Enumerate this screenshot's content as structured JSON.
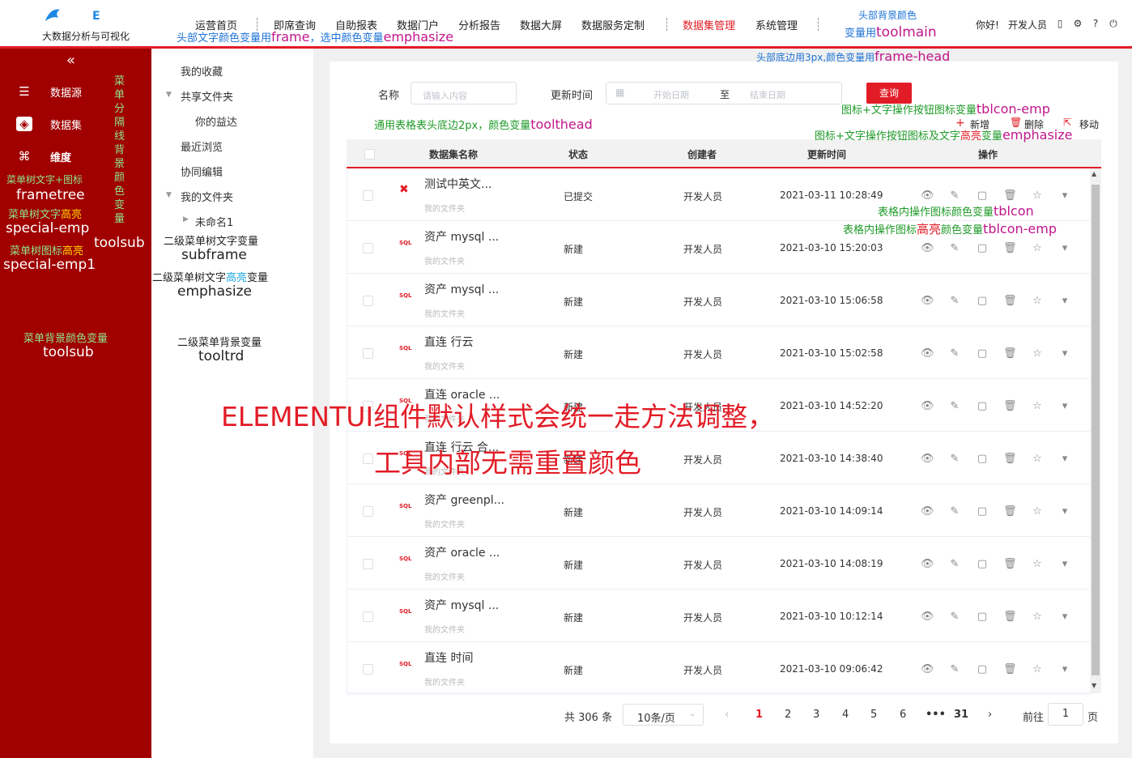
{
  "header": {
    "logo_e": "E",
    "logo_title": "大数据分析与可视化",
    "nav": [
      "运营首页",
      "即席查询",
      "自助报表",
      "数据门户",
      "分析报告",
      "数据大屏",
      "数据服务定制",
      "数据集管理",
      "系统管理"
    ],
    "active_nav": "数据集管理",
    "greeting": "你好!",
    "user": "开发人员",
    "icons": [
      "phone-icon",
      "gear-icon",
      "help-icon",
      "power-icon"
    ]
  },
  "sidebar": {
    "collapse_icon": "double-chevron-left-icon",
    "items": [
      {
        "label": "数据源",
        "icon": "database-icon"
      },
      {
        "label": "数据集",
        "icon": "layers-icon",
        "active": true
      },
      {
        "label": "维度",
        "icon": "nodes-icon"
      }
    ]
  },
  "subnav": {
    "items": [
      "我的收藏",
      "共享文件夹",
      "你的益达",
      "最近浏览",
      "协同编辑",
      "我的文件夹",
      "未命名1"
    ]
  },
  "filters": {
    "name_label": "名称",
    "name_placeholder": "请输入内容",
    "time_label": "更新时间",
    "start_placeholder": "开始日期",
    "to": "至",
    "end_placeholder": "结束日期",
    "query": "查询"
  },
  "toolbar": {
    "add": "新增",
    "delete": "删除",
    "move": "移动"
  },
  "table": {
    "headers": [
      "数据集名称",
      "状态",
      "创建者",
      "更新时间",
      "操作"
    ],
    "rows": [
      {
        "name": "测试中英文...",
        "folder": "我的文件夹",
        "status": "已提交",
        "creator": "开发人员",
        "time": "2021-03-11 10:28:49",
        "type": "x"
      },
      {
        "name": "资产 mysql ...",
        "folder": "我的文件夹",
        "status": "新建",
        "creator": "开发人员",
        "time": "2021-03-10 15:20:03",
        "type": "SQL"
      },
      {
        "name": "资产 mysql ...",
        "folder": "我的文件夹",
        "status": "新建",
        "creator": "开发人员",
        "time": "2021-03-10 15:06:58",
        "type": "SQL"
      },
      {
        "name": "直连 行云",
        "folder": "我的文件夹",
        "status": "新建",
        "creator": "开发人员",
        "time": "2021-03-10 15:02:58",
        "type": "SQL"
      },
      {
        "name": "直连 oracle ...",
        "folder": "我的文件夹",
        "status": "新建",
        "creator": "开发人员",
        "time": "2021-03-10 14:52:20",
        "type": "SQL"
      },
      {
        "name": "直连 行云 合...",
        "folder": "我的文件夹",
        "status": "新建",
        "creator": "开发人员",
        "time": "2021-03-10 14:38:40",
        "type": "SQL"
      },
      {
        "name": "资产 greenpl...",
        "folder": "我的文件夹",
        "status": "新建",
        "creator": "开发人员",
        "time": "2021-03-10 14:09:14",
        "type": "SQL"
      },
      {
        "name": "资产 oracle ...",
        "folder": "我的文件夹",
        "status": "新建",
        "creator": "开发人员",
        "time": "2021-03-10 14:08:19",
        "type": "SQL"
      },
      {
        "name": "资产 mysql ...",
        "folder": "我的文件夹",
        "status": "新建",
        "creator": "开发人员",
        "time": "2021-03-10 10:12:14",
        "type": "SQL"
      },
      {
        "name": "直连 时间",
        "folder": "我的文件夹",
        "status": "新建",
        "creator": "开发人员",
        "time": "2021-03-10 09:06:42",
        "type": "SQL"
      }
    ],
    "row_ops": [
      "eye-icon",
      "edit-icon",
      "file-icon",
      "trash-icon",
      "star-icon",
      "caret-down-icon"
    ]
  },
  "pagination": {
    "total": "共 306 条",
    "page_size": "10条/页",
    "pages": [
      "1",
      "2",
      "3",
      "4",
      "5",
      "6",
      "•••",
      "31"
    ],
    "current": "1",
    "goto_label": "前往",
    "goto_value": "1",
    "goto_suffix": "页"
  },
  "annotations": {
    "a1": "头部背景颜色",
    "a2_pre": "变量用",
    "a2_var": "toolmain",
    "a3_pre": "头部文字颜色变量用",
    "a3_var1": "frame",
    "a3_mid": "，选中颜色变量",
    "a3_var2": "emphasize",
    "a4_pre": "头部底边用3px,颜色变量用",
    "a4_var": "frame-head",
    "a5": "菜单分隔线背景颜色变量",
    "a6": "菜单树文字+图标",
    "a7": "frametree",
    "a8_pre": "菜单树文字",
    "a8_hl": "高亮",
    "a9": "special-emp",
    "a10": "toolsub",
    "a11_pre": "菜单树图标",
    "a11_hl": "高亮",
    "a12": "special-emp1",
    "a13": "菜单背景颜色变量",
    "a14": "toolsub",
    "a15": "二级菜单树文字变量",
    "a16": "subframe",
    "a17_pre": "二级菜单树文字",
    "a17_hl": "高亮",
    "a17_post": "变量",
    "a18": "emphasize",
    "a19": "二级菜单背景变量",
    "a20": "tooltrd",
    "a21_pre": "通用表格表头底边2px，颜色变量",
    "a21_var": "toolthead",
    "a22_pre": "图标+文字操作按钮图标变量",
    "a22_var": "tblcon-emp",
    "a23_pre": "图标+文字操作按钮图标及文字",
    "a23_hl": "高亮",
    "a23_mid": "变量",
    "a23_var": "emphasize",
    "a24_pre": "表格内操作图标颜色变量",
    "a24_var": "tblcon",
    "a25_pre": "表格内操作图标",
    "a25_hl": "高亮",
    "a25_mid": "颜色变量",
    "a25_var": "tblcon-emp",
    "big1": "ELEMENTUI组件默认样式会统一走方法调整，",
    "big2": "工具内部无需重置颜色"
  }
}
